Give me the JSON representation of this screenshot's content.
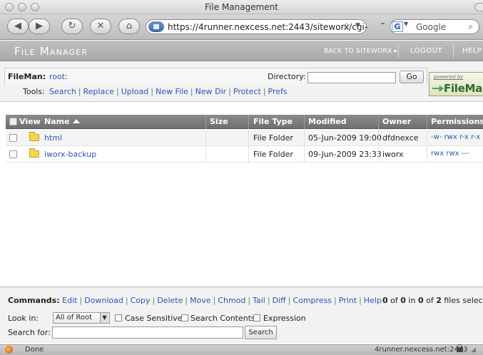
{
  "window": {
    "title": "File Management"
  },
  "browser": {
    "url": "https://4runner.nexcess.net:2443/siteworx/cgi-",
    "search_placeholder": "Google",
    "search_engine_letter": "G"
  },
  "banner": {
    "app_title": "File Manager",
    "back_link": "BACK TO SITEWORX ▸",
    "logout": "LOGOUT",
    "help": "HELP"
  },
  "info": {
    "fileman_label": "FileMan:",
    "root_path": "root:",
    "directory_label": "Directory:",
    "directory_value": "",
    "go_label": "Go",
    "tools_label": "Tools:",
    "tools": [
      "Search",
      "Replace",
      "Upload",
      "New File",
      "New Dir",
      "Protect",
      "Prefs"
    ],
    "powered_by": "powered by",
    "logo_text": "FileMan"
  },
  "table": {
    "columns": [
      "View",
      "Name",
      "Size",
      "File Type",
      "Modified",
      "Owner",
      "Permissions"
    ],
    "rows": [
      {
        "name": "html",
        "size": "",
        "type": "File Folder",
        "modified": "05-Jun-2009 19:00",
        "owner": "dfdnexce",
        "permissions": "-w- rwx r-x r-x"
      },
      {
        "name": "iworx-backup",
        "size": "",
        "type": "File Folder",
        "modified": "09-Jun-2009 23:33",
        "owner": "iworx",
        "permissions": "rwx rwx ---"
      }
    ]
  },
  "commands": {
    "label": "Commands:",
    "items": [
      "Edit",
      "Download",
      "Copy",
      "Delete",
      "Move",
      "Chmod",
      "Tail",
      "Diff",
      "Compress",
      "Print",
      "Help"
    ],
    "count_a": "0",
    "count_of": "of",
    "count_b": "0",
    "count_in": "in",
    "count_c": "0",
    "count_of2": "of",
    "count_d": "2",
    "count_suffix": "files selected"
  },
  "search": {
    "look_in_label": "Look in:",
    "look_in_value": "All of Root",
    "case_sensitive": "Case Sensitive",
    "search_contents": "Search Contents",
    "expression": "Expression",
    "search_for_label": "Search for:",
    "search_for_value": "",
    "search_button": "Search"
  },
  "status": {
    "text": "Done",
    "host": "4runner.nexcess.net:2443"
  }
}
